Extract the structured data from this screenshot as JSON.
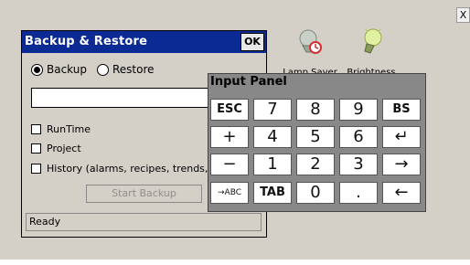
{
  "topbar": {
    "close_label": "X"
  },
  "launchers": [
    {
      "label": "Lamp Saver",
      "icon": "lamp-saver-icon"
    },
    {
      "label": "Brightness",
      "icon": "brightness-icon"
    }
  ],
  "dialog": {
    "title": "Backup & Restore",
    "ok_label": "OK",
    "mode_options": [
      {
        "label": "Backup",
        "selected": true
      },
      {
        "label": "Restore",
        "selected": false
      }
    ],
    "path_value": "",
    "checkboxes": [
      {
        "label": "RunTime",
        "checked": false
      },
      {
        "label": "Project",
        "checked": false
      },
      {
        "label": "History (alarms, recipes, trends, v",
        "checked": false
      }
    ],
    "start_button": "Start Backup",
    "status": "Ready"
  },
  "input_panel": {
    "title": "Input Panel",
    "rows": [
      [
        "ESC",
        "7",
        "8",
        "9",
        "BS"
      ],
      [
        "+",
        "4",
        "5",
        "6",
        "↵"
      ],
      [
        "−",
        "1",
        "2",
        "3",
        "→"
      ],
      [
        "→ABC",
        "TAB",
        "0",
        ".",
        "←"
      ]
    ]
  }
}
